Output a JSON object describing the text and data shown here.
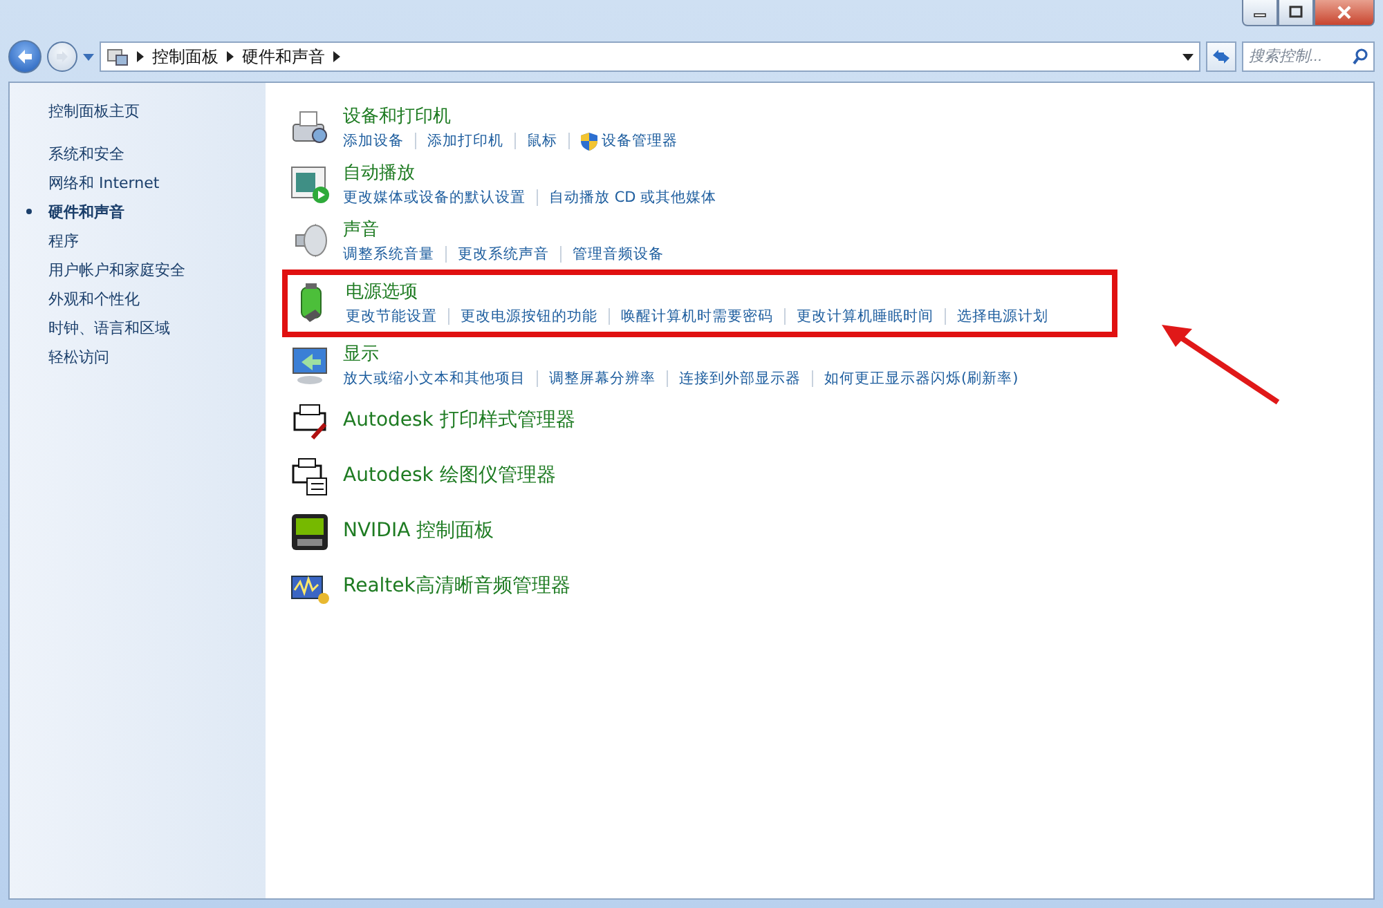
{
  "address_bar": {
    "breadcrumbs": [
      "控制面板",
      "硬件和声音"
    ]
  },
  "search": {
    "placeholder": "搜索控制..."
  },
  "sidebar": {
    "home": "控制面板主页",
    "items": [
      {
        "label": "系统和安全",
        "selected": false
      },
      {
        "label": "网络和 Internet",
        "selected": false
      },
      {
        "label": "硬件和声音",
        "selected": true
      },
      {
        "label": "程序",
        "selected": false
      },
      {
        "label": "用户帐户和家庭安全",
        "selected": false
      },
      {
        "label": "外观和个性化",
        "selected": false
      },
      {
        "label": "时钟、语言和区域",
        "selected": false
      },
      {
        "label": "轻松访问",
        "selected": false
      }
    ]
  },
  "categories": [
    {
      "kind": "category",
      "title": "设备和打印机",
      "highlighted": false,
      "links": [
        {
          "label": "添加设备",
          "shield": false
        },
        {
          "label": "添加打印机",
          "shield": false
        },
        {
          "label": "鼠标",
          "shield": false
        },
        {
          "label": "设备管理器",
          "shield": true
        }
      ]
    },
    {
      "kind": "category",
      "title": "自动播放",
      "highlighted": false,
      "links": [
        {
          "label": "更改媒体或设备的默认设置",
          "shield": false
        },
        {
          "label": "自动播放 CD 或其他媒体",
          "shield": false
        }
      ]
    },
    {
      "kind": "category",
      "title": "声音",
      "highlighted": false,
      "links": [
        {
          "label": "调整系统音量",
          "shield": false
        },
        {
          "label": "更改系统声音",
          "shield": false
        },
        {
          "label": "管理音频设备",
          "shield": false
        }
      ]
    },
    {
      "kind": "category",
      "title": "电源选项",
      "highlighted": true,
      "links": [
        {
          "label": "更改节能设置",
          "shield": false
        },
        {
          "label": "更改电源按钮的功能",
          "shield": false
        },
        {
          "label": "唤醒计算机时需要密码",
          "shield": false
        },
        {
          "label": "更改计算机睡眠时间",
          "shield": false
        },
        {
          "label": "选择电源计划",
          "shield": false
        }
      ]
    },
    {
      "kind": "category",
      "title": "显示",
      "highlighted": false,
      "links": [
        {
          "label": "放大或缩小文本和其他项目",
          "shield": false
        },
        {
          "label": "调整屏幕分辨率",
          "shield": false
        },
        {
          "label": "连接到外部显示器",
          "shield": false
        },
        {
          "label": "如何更正显示器闪烁(刷新率)",
          "shield": false
        }
      ]
    },
    {
      "kind": "app",
      "title": "Autodesk 打印样式管理器",
      "highlighted": false
    },
    {
      "kind": "app",
      "title": "Autodesk 绘图仪管理器",
      "highlighted": false
    },
    {
      "kind": "app",
      "title": "NVIDIA 控制面板",
      "highlighted": false
    },
    {
      "kind": "app",
      "title": "Realtek高清晰音频管理器",
      "highlighted": false
    }
  ]
}
